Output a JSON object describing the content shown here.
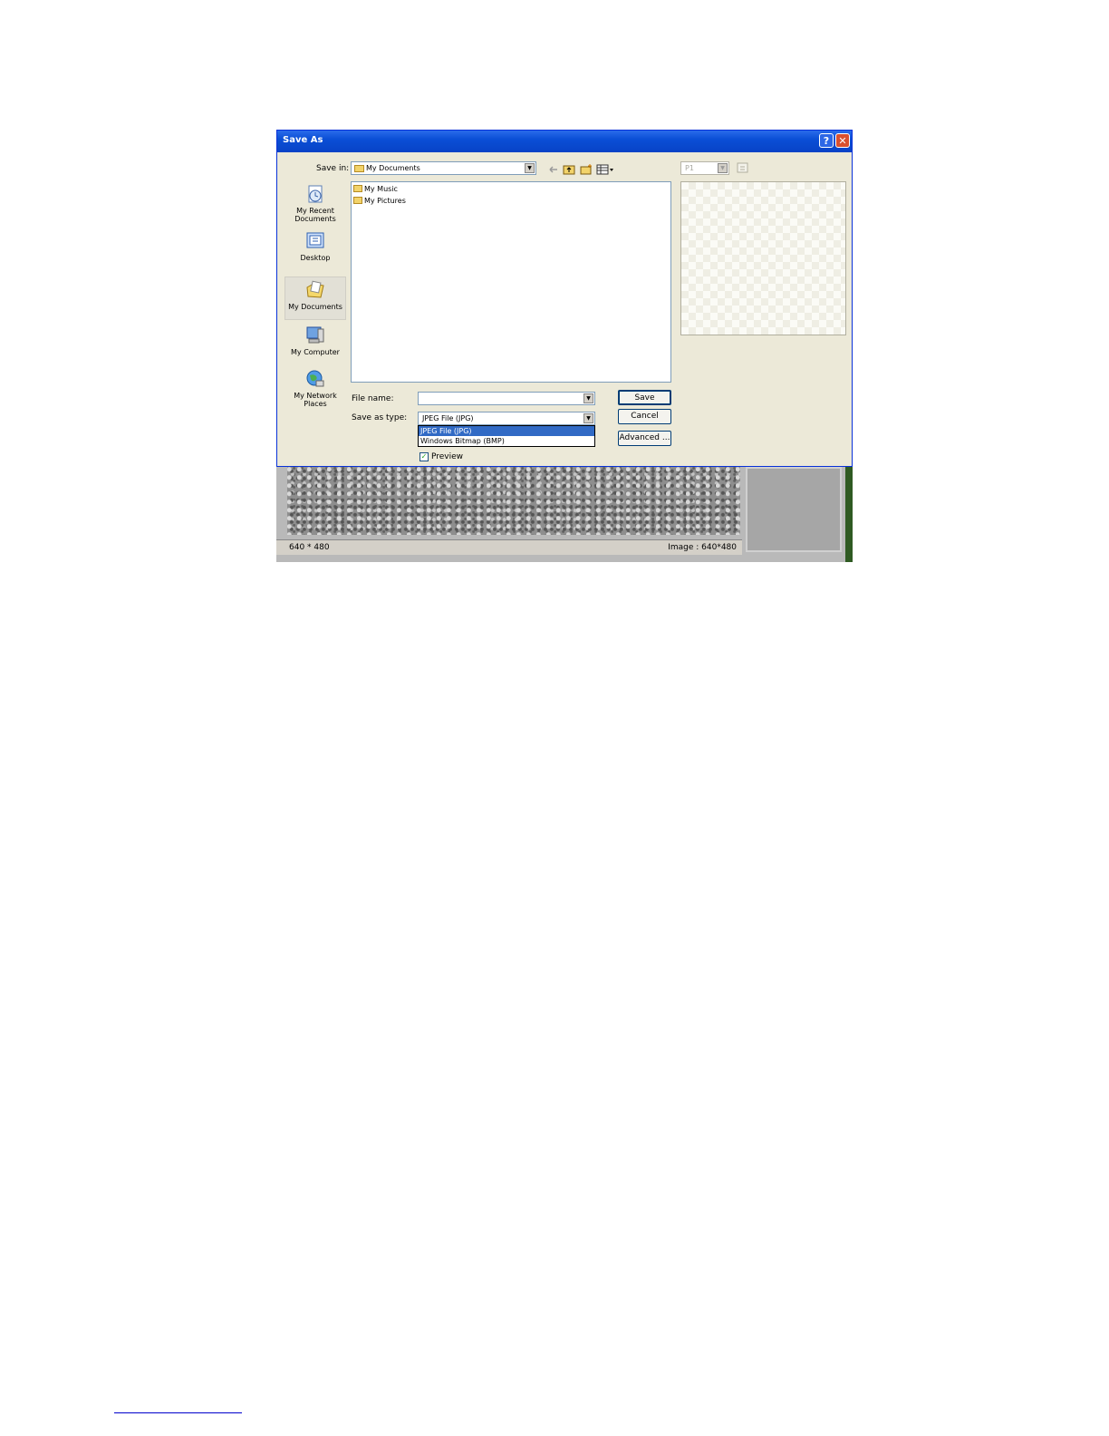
{
  "dialog": {
    "title": "Save As",
    "help_button": "?",
    "close_button": "✕",
    "save_in_label": "Save in:",
    "save_in_value": "My Documents",
    "page_combo_value": "P1",
    "places": [
      {
        "label": "My Recent Documents",
        "icon": "recent-documents-icon"
      },
      {
        "label": "Desktop",
        "icon": "desktop-icon"
      },
      {
        "label": "My Documents",
        "icon": "my-documents-icon",
        "selected": true
      },
      {
        "label": "My Computer",
        "icon": "my-computer-icon"
      },
      {
        "label": "My Network Places",
        "icon": "network-places-icon"
      }
    ],
    "files": [
      "My Music",
      "My Pictures"
    ],
    "file_name_label": "File name:",
    "file_name_value": "",
    "save_as_type_label": "Save as type:",
    "save_as_type_value": "JPEG File (JPG)",
    "type_options": [
      "JPEG File (JPG)",
      "Windows Bitmap (BMP)"
    ],
    "selected_type_index": 0,
    "save_button": "Save",
    "cancel_button": "Cancel",
    "advanced_button": "Advanced ...",
    "preview_label": "Preview",
    "preview_checked": true
  },
  "background_app": {
    "status_left": "640 * 480",
    "status_right": "Image : 640*480"
  },
  "colors": {
    "titlebar": "#0a4fd6",
    "dialog_bg": "#ece9d8",
    "selection": "#316ac5"
  }
}
